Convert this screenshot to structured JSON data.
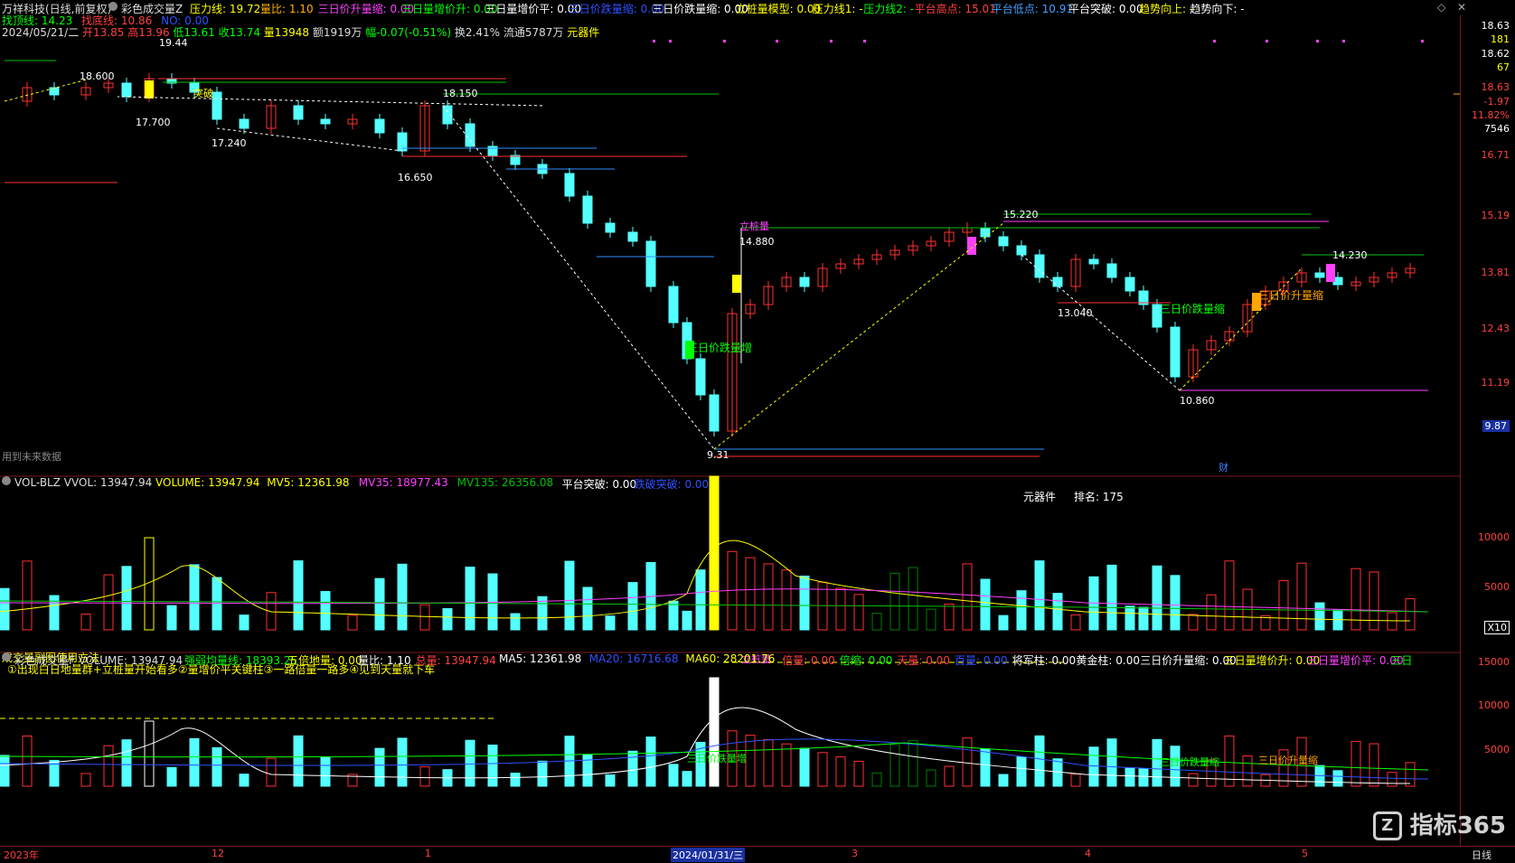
{
  "header": {
    "stock": "万祥科技(日线,前复权)",
    "indicator": "彩色成交量Z",
    "items": [
      {
        "t": "压力线: 19.72",
        "c": "#ffff00"
      },
      {
        "t": "量比: 1.10",
        "c": "#ffb000"
      },
      {
        "t": "三日价升量缩: 0.00",
        "c": "#ff40ff"
      },
      {
        "t": "三日量增价升: 0.00",
        "c": "#00ff00"
      },
      {
        "t": "三日量增价平: 0.00",
        "c": "#ffffff"
      },
      {
        "t": "三日价跌量缩: 0.00",
        "c": "#3050ff"
      },
      {
        "t": "三日价跌量缩: 0.00",
        "c": "#ffffff"
      },
      {
        "t": "立桩量模型: 0.00",
        "c": "#ffff00"
      },
      {
        "t": "压力线1: -",
        "c": "#ffff00"
      },
      {
        "t": "压力线2: -",
        "c": "#00ff00"
      },
      {
        "t": "平台高点: 15.01",
        "c": "#ff4040"
      },
      {
        "t": "平台低点: 10.91",
        "c": "#40a0ff"
      },
      {
        "t": "平台突破: 0.00",
        "c": "#ffffff"
      },
      {
        "t": "趋势向上: -",
        "c": "#ffff00"
      },
      {
        "t": "趋势向下: -",
        "c": "#ffffff"
      }
    ]
  },
  "info": {
    "l1": "找顶线: 14.23",
    "l2": "找底线: 10.86",
    "l3": "NO: 0.00",
    "date": "2024/05/21/二",
    "open": "开13.85",
    "high": "高13.96",
    "low": "低13.61",
    "close": "收13.74",
    "vol": "量13948",
    "amt": "额1919万",
    "chg": "幅-0.07(-0.51%)",
    "turn": "换2.41%",
    "float": "流通5787万",
    "tag": "元器件"
  },
  "price_labels": {
    "p1": "18.600",
    "p2": "19.44",
    "p3": "17.700",
    "p4": "17.240",
    "p5": "18.150",
    "p6": "16.650",
    "p7": "14.880",
    "p8": "9.31",
    "p9": "15.220",
    "p10": "13.040",
    "p11": "14.230",
    "p12": "10.860",
    "sig1": "三日价跌量增",
    "sig2": "三日价跌量缩",
    "sig3": "三日价升量缩",
    "sig4": "立桩量",
    "sig5": "突破",
    "future": "用到未来数据",
    "cai": "财"
  },
  "price_axis": [
    {
      "t": "18.63",
      "c": "#ffffff"
    },
    {
      "t": "181",
      "c": "#ffff00"
    },
    {
      "t": "18.62",
      "c": "#ffffff"
    },
    {
      "t": "67",
      "c": "#ffff00"
    },
    {
      "t": "18.63",
      "c": "#ff4040"
    },
    {
      "t": "-1.97",
      "c": "#ff4040"
    },
    {
      "t": "11.82%",
      "c": "#ff4040"
    },
    {
      "t": "7546",
      "c": "#ffffff"
    },
    {
      "t": "16.71",
      "c": "#ff4040"
    },
    {
      "t": "15.19",
      "c": "#ff4040"
    },
    {
      "t": "13.81",
      "c": "#ff4040"
    },
    {
      "t": "12.43",
      "c": "#ff4040"
    },
    {
      "t": "11.19",
      "c": "#ff4040"
    },
    {
      "t": "9.87",
      "c": "#ffffff"
    }
  ],
  "vol_panel": {
    "title": "VOL-BLZ VVOL: 13947.94",
    "items": [
      {
        "t": "VOLUME: 13947.94",
        "c": "#ffff00"
      },
      {
        "t": "MV5: 12361.98",
        "c": "#ffff00"
      },
      {
        "t": "MV35: 18977.43",
        "c": "#ff40ff"
      },
      {
        "t": "MV135: 26356.08",
        "c": "#00c000"
      },
      {
        "t": "平台突破: 0.00",
        "c": "#ffffff"
      },
      {
        "t": "跌破突破: 0.00",
        "c": "#3050ff"
      }
    ],
    "sector": "元器件",
    "rank": "排名: 175",
    "axis": [
      "10000",
      "5000",
      "X10"
    ]
  },
  "vol2_panel": {
    "title": "彩色成交量F VOLUME: 13947.94",
    "items": [
      {
        "t": "强弱均量线: 18393.25",
        "c": "#00ff00"
      },
      {
        "t": "五倍地量: 0.00",
        "c": "#ffff00"
      },
      {
        "t": "量比: 1.10",
        "c": "#ffffff"
      },
      {
        "t": "总量: 13947.94",
        "c": "#ff4040"
      },
      {
        "t": "MA5: 12361.98",
        "c": "#ffffff"
      },
      {
        "t": "MA20: 16716.68",
        "c": "#3050ff"
      },
      {
        "t": "MA60: 28201.76",
        "c": "#ffff00"
      },
      {
        "t": "倍量: 0.00",
        "c": "#ff4040"
      },
      {
        "t": "倍缩: 0.00",
        "c": "#00ff00"
      },
      {
        "t": "天量: 0.00",
        "c": "#ff4040"
      },
      {
        "t": "百量: 0.00",
        "c": "#3050ff"
      },
      {
        "t": "将军柱: 0.00",
        "c": "#ffffff"
      },
      {
        "t": "黄金柱: 0.00",
        "c": "#ffffff"
      },
      {
        "t": "三日价升量缩: 0.00",
        "c": "#ffffff"
      },
      {
        "t": "三日量增价升: 0.00",
        "c": "#ffff00"
      },
      {
        "t": "三日量增价平: 0.00",
        "c": "#ff40ff"
      },
      {
        "t": "三日",
        "c": "#00ff00"
      }
    ],
    "help1": "成交量副图使用方法:",
    "help2": "①出现白日地量群+立桩量开始看多②量增价平关键柱③一路倍量一路多④见到天量就下车",
    "sig_lizhuang": "立桩量",
    "sig_a": "三日价跌量增",
    "sig_b": "三日价跌量缩",
    "sig_c": "三日价升量缩",
    "axis": [
      "15000",
      "10000",
      "5000"
    ]
  },
  "bottom": {
    "b1": "2023年",
    "b2": "12",
    "b3": "1",
    "b4": "2024/01/31/三",
    "b5": "3",
    "b6": "4",
    "b7": "5",
    "b8": "日线"
  },
  "watermark": "指标365"
}
